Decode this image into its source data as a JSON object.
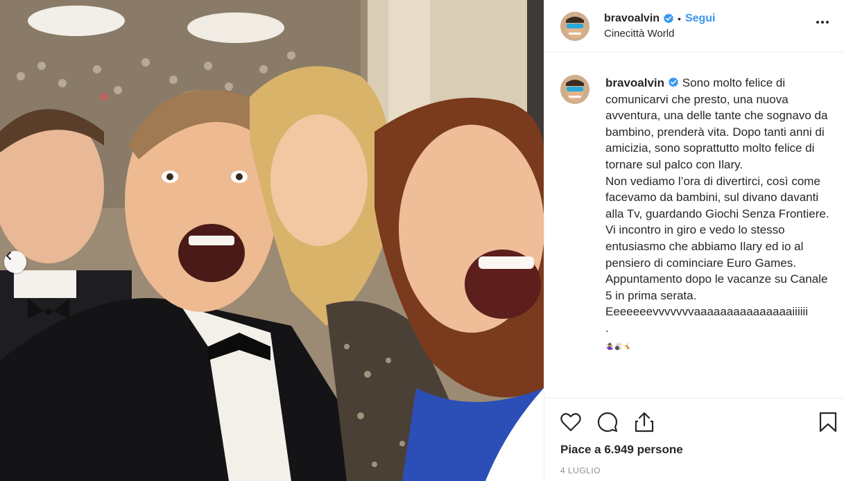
{
  "post": {
    "username": "bravoalvin",
    "separator": "•",
    "follow_label": "Segui",
    "location": "Cinecittà World",
    "more_label": "•••",
    "caption_username": "bravoalvin",
    "caption_body": "Sono molto felice di comunicarvi che presto, una nuova avventura, una delle tante che sognavo da bambino, prenderà vita. Dopo tanti anni di amicizia, sono soprattutto molto felice di tornare sul palco con Ilary.\nNon vediamo l’ora di divertirci, così come facevamo da bambini, sul divano davanti alla Tv, guardando Giochi Senza Frontiere.\nVi incontro in giro e vedo lo stesso entusiasmo che abbiamo Ilary ed io al pensiero di cominciare Euro Games.\nAppuntamento dopo le vacanze su Canale 5 in prima serata.\nEeeeeeevvvvvvvaaaaaaaaaaaaaaaiiiiii\n.",
    "caption_emoji": "🤹‍♀️🎳🤸",
    "likes_text": "Piace a 6.949 persone",
    "date_text": "4 LUGLIO"
  },
  "icons": {
    "verified": "verified-badge-icon",
    "like": "heart-icon",
    "comment": "comment-bubble-icon",
    "share": "share-icon",
    "save": "bookmark-icon",
    "prev": "chevron-left-icon",
    "more": "more-options-icon"
  },
  "colors": {
    "accent": "#3897f0",
    "text": "#262626",
    "muted": "#8e8e8e",
    "border": "#efefef"
  }
}
